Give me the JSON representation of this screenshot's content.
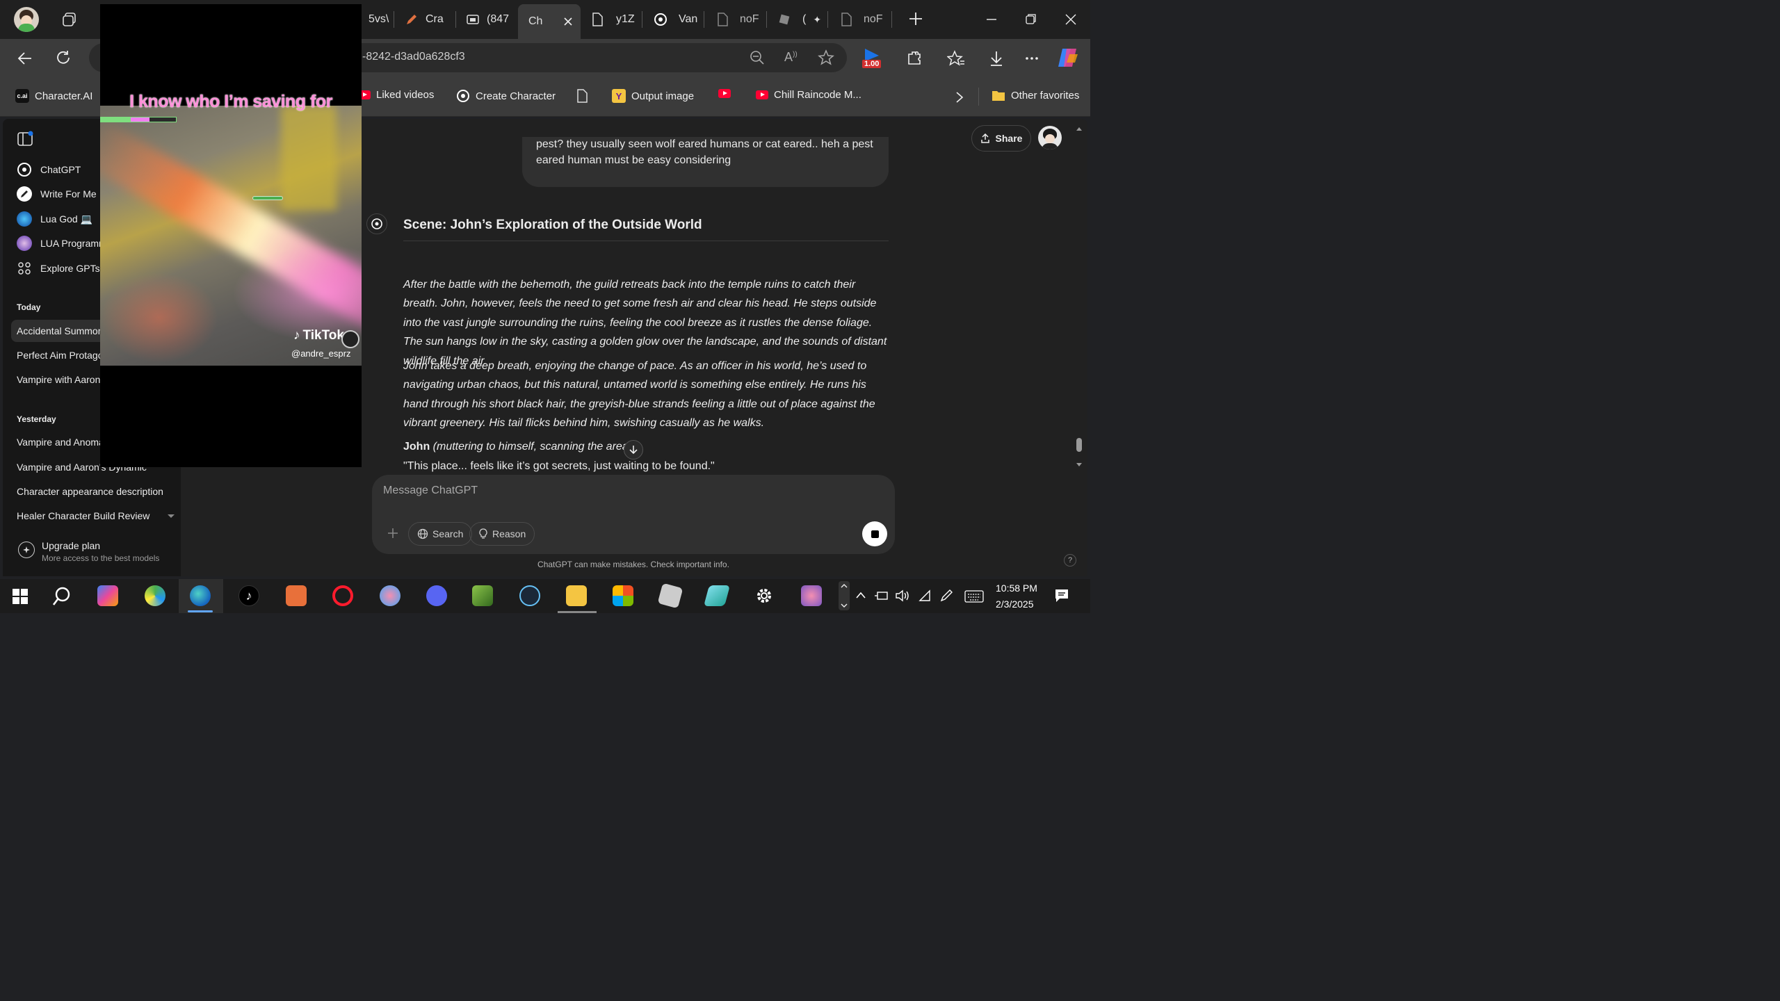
{
  "tabs": [
    {
      "label": "5vs\\",
      "icon": "tab-icon"
    },
    {
      "label": "Cra",
      "icon": "pen-icon"
    },
    {
      "label": "(847",
      "icon": "media-icon"
    },
    {
      "label": "Ch",
      "icon": "chatgpt-icon",
      "active": true
    },
    {
      "label": "y1Z",
      "icon": "page-icon"
    },
    {
      "label": "Van",
      "icon": "openai-icon"
    },
    {
      "label": "noF",
      "icon": "page-icon"
    },
    {
      "label": "(",
      "icon": "roblox-icon"
    },
    {
      "label": "noF",
      "icon": "page-icon"
    }
  ],
  "toolbar": {
    "url": "-8242-d3ad0a628cf3",
    "zoom_badge": "1.00"
  },
  "favorites": {
    "items": [
      "Character.AI",
      "Liked videos",
      "Create Character",
      "Output image",
      "Chill Raincode M..."
    ],
    "other": "Other favorites"
  },
  "sidebar": {
    "gpts": [
      {
        "label": "ChatGPT",
        "icon": "openai-icon"
      },
      {
        "label": "Write For Me",
        "icon": "pen-icon"
      },
      {
        "label": "Lua God 💻",
        "icon": "gpt-avatar-icon"
      },
      {
        "label": "LUA Programmer",
        "icon": "gpt-avatar-icon"
      },
      {
        "label": "Explore GPTs",
        "icon": "grid-icon"
      }
    ],
    "today_label": "Today",
    "today": [
      "Accidental Summoning",
      "Perfect Aim Protagonist",
      "Vampire with Aaron"
    ],
    "yesterday_label": "Yesterday",
    "yesterday": [
      "Vampire and Anomaly",
      "Vampire and Aaron's Dynamic",
      "Character appearance description",
      "Healer Character Build Review"
    ],
    "upgrade_title": "Upgrade plan",
    "upgrade_sub": "More access to the best models"
  },
  "chat": {
    "share_label": "Share",
    "user_message": "pest? they usually seen wolf eared humans or cat eared.. heh a pest eared human must be easy considering",
    "heading": "Scene: John’s Exploration of the Outside World",
    "para1": "After the battle with the behemoth, the guild retreats back into the temple ruins to catch their breath. John, however, feels the need to get some fresh air and clear his head. He steps outside into the vast jungle surrounding the ruins, feeling the cool breeze as it rustles the dense foliage. The sun hangs low in the sky, casting a golden glow over the landscape, and the sounds of distant wildlife fill the air.",
    "para2": "John takes a deep breath, enjoying the change of pace. As an officer in his world, he’s used to navigating urban chaos, but this natural, untamed world is something else entirely. He runs his hand through his short black hair, the greyish-blue strands feeling a little out of place against the vibrant greenery. His tail flicks behind him, swishing casually as he walks.",
    "speaker": "John",
    "speaker_note": "(muttering to himself, scanning the area):",
    "quote": "\"This place... feels like it’s got secrets, just waiting to be found.\""
  },
  "composer": {
    "placeholder": "Message ChatGPT",
    "search_label": "Search",
    "reason_label": "Reason",
    "disclaimer": "ChatGPT can make mistakes. Check important info.",
    "help": "?"
  },
  "video": {
    "caption": "I know who I’m saving for",
    "brand": "TikTok",
    "handle": "@andre_esprz"
  },
  "taskbar": {
    "time": "10:58 PM",
    "date": "2/3/2025"
  },
  "colors": {
    "accent_blue": "#1a73e8",
    "caption_pink": "#ff8fd8",
    "youtube_red": "#ff0033"
  }
}
